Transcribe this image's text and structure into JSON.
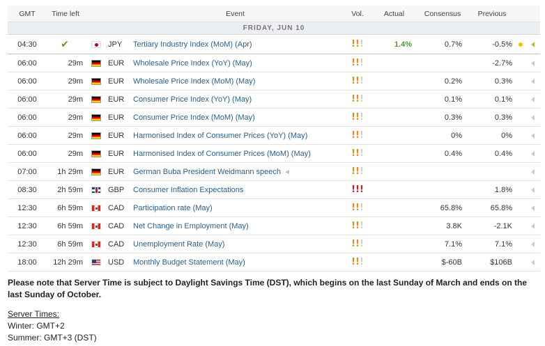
{
  "header": {
    "gmt": "GMT",
    "time_left": "Time left",
    "event": "Event",
    "vol": "Vol.",
    "actual": "Actual",
    "consensus": "Consensus",
    "previous": "Previous"
  },
  "day_label": "FRIDAY, JUN 10",
  "events": [
    {
      "gmt": "04:30",
      "time_left": "",
      "done": true,
      "flag": "jp",
      "currency": "JPY",
      "event": "Tertiary Industry Index (MoM) (Apr)",
      "volatility": 2,
      "actual": "1.4%",
      "consensus": "0.7%",
      "previous": "-0.5%"
    },
    {
      "gmt": "06:00",
      "time_left": "29m",
      "done": false,
      "flag": "de",
      "currency": "EUR",
      "event": "Wholesale Price Index (YoY) (May)",
      "volatility": 2,
      "actual": "",
      "consensus": "",
      "previous": "-2.7%"
    },
    {
      "gmt": "06:00",
      "time_left": "29m",
      "done": false,
      "flag": "de",
      "currency": "EUR",
      "event": "Wholesale Price Index (MoM) (May)",
      "volatility": 2,
      "actual": "",
      "consensus": "0.2%",
      "previous": "0.3%"
    },
    {
      "gmt": "06:00",
      "time_left": "29m",
      "done": false,
      "flag": "de",
      "currency": "EUR",
      "event": "Consumer Price Index (YoY) (May)",
      "volatility": 2,
      "actual": "",
      "consensus": "0.1%",
      "previous": "0.1%"
    },
    {
      "gmt": "06:00",
      "time_left": "29m",
      "done": false,
      "flag": "de",
      "currency": "EUR",
      "event": "Consumer Price Index (MoM) (May)",
      "volatility": 2,
      "actual": "",
      "consensus": "0.3%",
      "previous": "0.3%"
    },
    {
      "gmt": "06:00",
      "time_left": "29m",
      "done": false,
      "flag": "de",
      "currency": "EUR",
      "event": "Harmonised Index of Consumer Prices (YoY) (May)",
      "volatility": 2,
      "actual": "",
      "consensus": "0%",
      "previous": "0%"
    },
    {
      "gmt": "06:00",
      "time_left": "29m",
      "done": false,
      "flag": "de",
      "currency": "EUR",
      "event": "Harmonised Index of Consumer Prices (MoM) (May)",
      "volatility": 2,
      "actual": "",
      "consensus": "0.4%",
      "previous": "0.4%"
    },
    {
      "gmt": "07:00",
      "time_left": "1h 29m",
      "done": false,
      "flag": "de",
      "currency": "EUR",
      "event": "German Buba President Weidmann speech",
      "speech": true,
      "volatility": 2,
      "actual": "",
      "consensus": "",
      "previous": ""
    },
    {
      "gmt": "08:30",
      "time_left": "2h 59m",
      "done": false,
      "flag": "gb",
      "currency": "GBP",
      "event": "Consumer Inflation Expectations",
      "volatility": 3,
      "actual": "",
      "consensus": "",
      "previous": "1.8%"
    },
    {
      "gmt": "12:30",
      "time_left": "6h 59m",
      "done": false,
      "flag": "ca",
      "currency": "CAD",
      "event": "Participation rate (May)",
      "volatility": 2,
      "actual": "",
      "consensus": "65.8%",
      "previous": "65.8%"
    },
    {
      "gmt": "12:30",
      "time_left": "6h 59m",
      "done": false,
      "flag": "ca",
      "currency": "CAD",
      "event": "Net Change in Employment (May)",
      "volatility": 2,
      "actual": "",
      "consensus": "3.8K",
      "previous": "-2.1K"
    },
    {
      "gmt": "12:30",
      "time_left": "6h 59m",
      "done": false,
      "flag": "ca",
      "currency": "CAD",
      "event": "Unemployment Rate (May)",
      "volatility": 2,
      "actual": "",
      "consensus": "7.1%",
      "previous": "7.1%"
    },
    {
      "gmt": "18:00",
      "time_left": "12h 29m",
      "done": false,
      "flag": "us",
      "currency": "USD",
      "event": "Monthly Budget Statement (May)",
      "volatility": 2,
      "actual": "",
      "consensus": "$-60B",
      "previous": "$106B"
    }
  ],
  "note": "Please note that Server Time is subject to Daylight Savings Time (DST), which begins on the last Sunday of March and ends on the last Sunday of October.",
  "server_times": {
    "title": "Server Times:",
    "winter": "Winter: GMT+2",
    "summer": "Summer: GMT+3 (DST)"
  },
  "colors": {
    "link": "#2c5f8a",
    "actual_positive": "#4a9a2c",
    "vol_medium": "#e68a1c",
    "vol_high": "#c21f1f"
  }
}
